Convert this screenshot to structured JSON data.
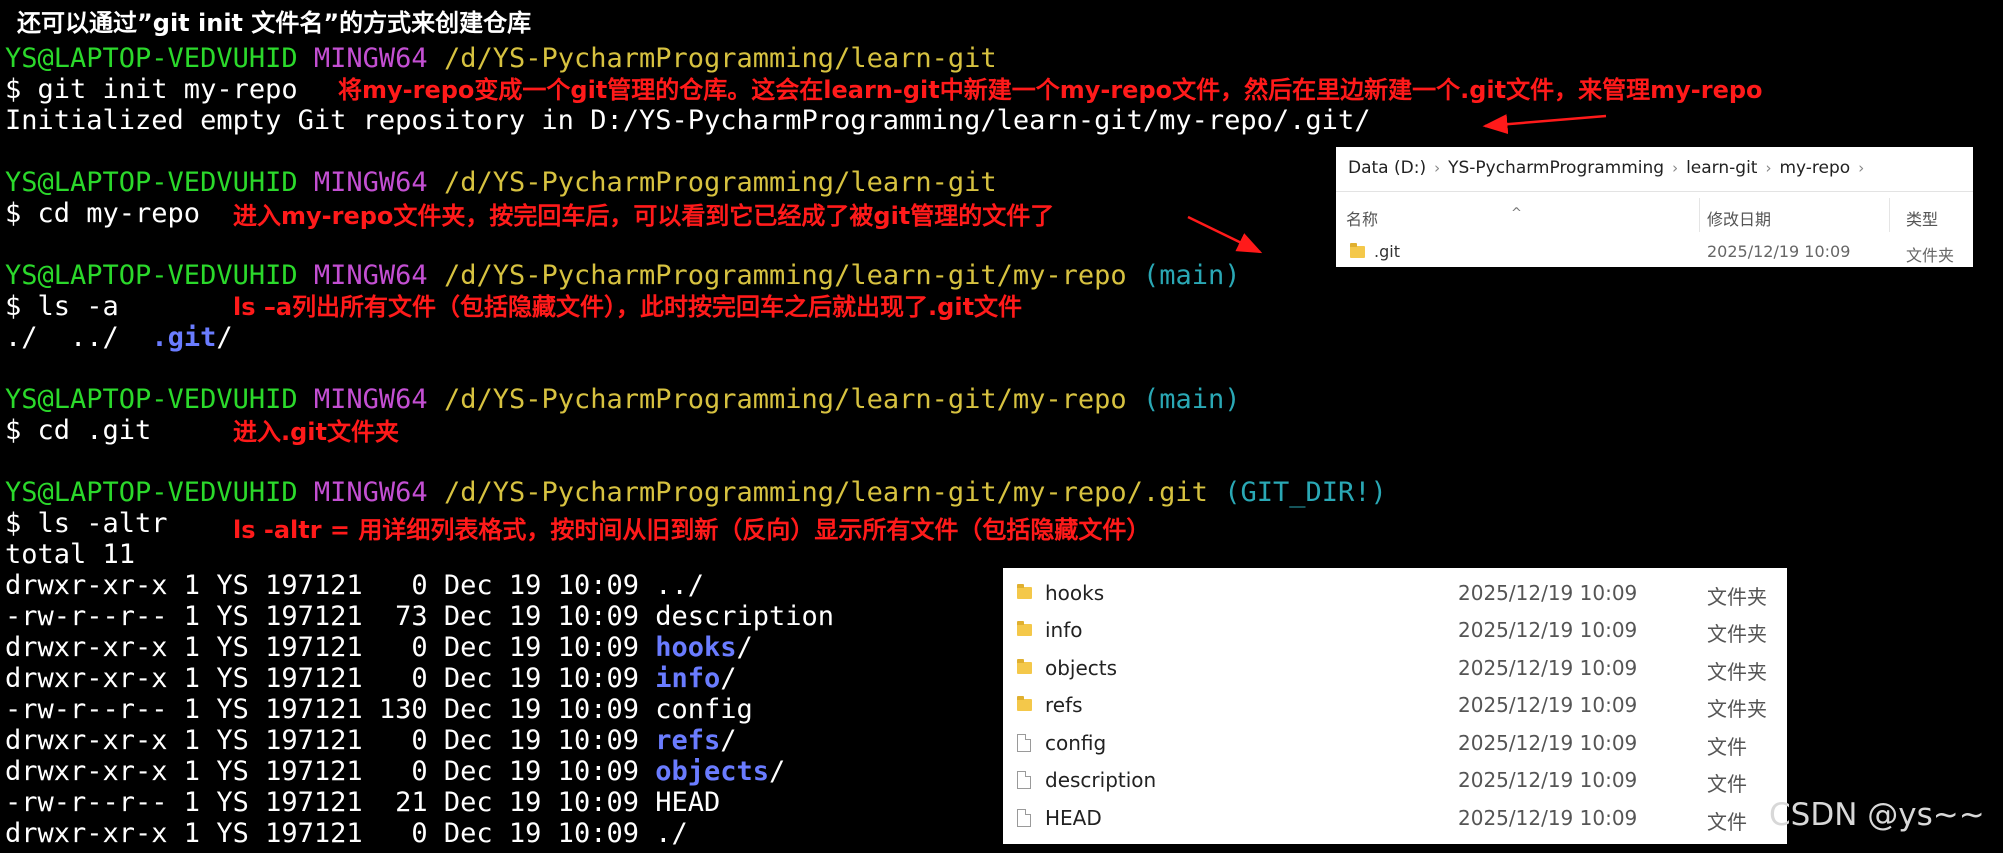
{
  "title": "还可以通过”git init 文件名”的方式来创建仓库",
  "prompt": {
    "user": "YS@LAPTOP-VEDVUHID",
    "shell": "MINGW64"
  },
  "blocks": [
    {
      "path": "/d/YS-PycharmProgramming/learn-git",
      "branch": "",
      "command": "$ git init my-repo",
      "annotation": "将my-repo变成一个git管理的仓库。这会在learn-git中新建一个my-repo文件，然后在里边新建一个.git文件，来管理my-repo",
      "output": "Initialized empty Git repository in D:/YS-PycharmProgramming/learn-git/my-repo/.git/"
    },
    {
      "path": "/d/YS-PycharmProgramming/learn-git",
      "branch": "",
      "command": "$ cd my-repo",
      "annotation": "进入my-repo文件夹，按完回车后，可以看到它已经成了被git管理的文件了"
    },
    {
      "path": "/d/YS-PycharmProgramming/learn-git/my-repo",
      "branch": "(main)",
      "command": "$ ls -a",
      "annotation": "ls –a列出所有文件（包括隐藏文件），此时按完回车之后就出现了.git文件",
      "output_parts": [
        "./  ../  ",
        ".git",
        "/"
      ]
    },
    {
      "path": "/d/YS-PycharmProgramming/learn-git/my-repo",
      "branch": "(main)",
      "command": "$ cd .git",
      "annotation": "进入.git文件夹"
    },
    {
      "path": "/d/YS-PycharmProgramming/learn-git/my-repo/.git",
      "branch": "(GIT_DIR!)",
      "command": "$ ls -altr",
      "annotation": "ls -altr = 用详细列表格式，按时间从旧到新（反向）显示所有文件（包括隐藏文件）",
      "total": "total 11"
    }
  ],
  "listing": [
    {
      "meta": "drwxr-xr-x 1 YS 197121   0 Dec 19 10:09 ",
      "name": "..",
      "suffix": "/",
      "dir": false
    },
    {
      "meta": "-rw-r--r-- 1 YS 197121  73 Dec 19 10:09 ",
      "name": "description",
      "suffix": "",
      "dir": false
    },
    {
      "meta": "drwxr-xr-x 1 YS 197121   0 Dec 19 10:09 ",
      "name": "hooks",
      "suffix": "/",
      "dir": true
    },
    {
      "meta": "drwxr-xr-x 1 YS 197121   0 Dec 19 10:09 ",
      "name": "info",
      "suffix": "/",
      "dir": true
    },
    {
      "meta": "-rw-r--r-- 1 YS 197121 130 Dec 19 10:09 ",
      "name": "config",
      "suffix": "",
      "dir": false
    },
    {
      "meta": "drwxr-xr-x 1 YS 197121   0 Dec 19 10:09 ",
      "name": "refs",
      "suffix": "/",
      "dir": true
    },
    {
      "meta": "drwxr-xr-x 1 YS 197121   0 Dec 19 10:09 ",
      "name": "objects",
      "suffix": "/",
      "dir": true
    },
    {
      "meta": "-rw-r--r-- 1 YS 197121  21 Dec 19 10:09 ",
      "name": "HEAD",
      "suffix": "",
      "dir": false
    },
    {
      "meta": "drwxr-xr-x 1 YS 197121   0 Dec 19 10:09 ",
      "name": ".",
      "suffix": "/",
      "dir": false
    }
  ],
  "explorer1": {
    "breadcrumb": [
      "Data (D:)",
      "YS-PycharmProgramming",
      "learn-git",
      "my-repo"
    ],
    "columns": {
      "name": "名称",
      "date": "修改日期",
      "type": "类型"
    },
    "rows": [
      {
        "name": ".git",
        "date": "2025/12/19 10:09",
        "type": "文件夹"
      }
    ]
  },
  "explorer2": {
    "rows": [
      {
        "name": "hooks",
        "date": "2025/12/19 10:09",
        "type": "文件夹",
        "kind": "folder"
      },
      {
        "name": "info",
        "date": "2025/12/19 10:09",
        "type": "文件夹",
        "kind": "folder"
      },
      {
        "name": "objects",
        "date": "2025/12/19 10:09",
        "type": "文件夹",
        "kind": "folder"
      },
      {
        "name": "refs",
        "date": "2025/12/19 10:09",
        "type": "文件夹",
        "kind": "folder"
      },
      {
        "name": "config",
        "date": "2025/12/19 10:09",
        "type": "文件",
        "kind": "file"
      },
      {
        "name": "description",
        "date": "2025/12/19 10:09",
        "type": "文件",
        "kind": "file"
      },
      {
        "name": "HEAD",
        "date": "2025/12/19 10:09",
        "type": "文件",
        "kind": "file"
      }
    ]
  },
  "watermark": "CSDN @ys~~",
  "colors": {
    "prompt_user": "#2bd92b",
    "prompt_shell": "#c34fd2",
    "prompt_path": "#d7c240",
    "branch": "#2aa8b5",
    "dir_name": "#6a7cff",
    "annotation": "#ff1a1a"
  }
}
